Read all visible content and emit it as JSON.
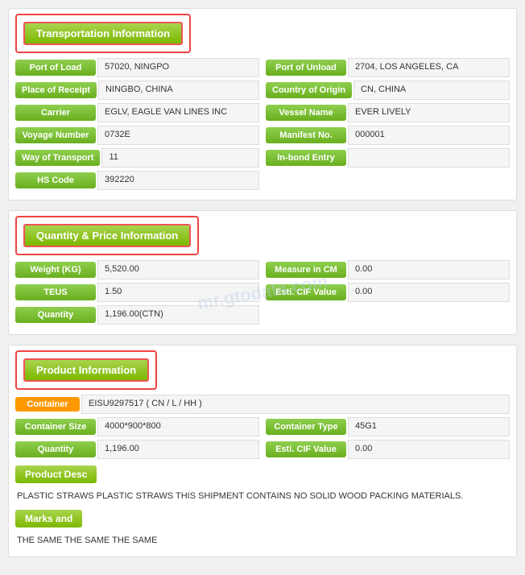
{
  "transportation": {
    "header": "Transportation Information",
    "fields": [
      {
        "left_label": "Port of Load",
        "left_value": "57020, NINGPO",
        "right_label": "Port of Unload",
        "right_value": "2704, LOS ANGELES, CA"
      },
      {
        "left_label": "Place of Receipt",
        "left_value": "NINGBO, CHINA",
        "right_label": "Country of Origin",
        "right_value": "CN, CHINA"
      },
      {
        "left_label": "Carrier",
        "left_value": "EGLV, EAGLE VAN LINES INC",
        "right_label": "Vessel Name",
        "right_value": "EVER LIVELY"
      },
      {
        "left_label": "Voyage Number",
        "left_value": "0732E",
        "right_label": "Manifest No.",
        "right_value": "000001"
      },
      {
        "left_label": "Way of Transport",
        "left_value": "11",
        "right_label": "In-bond Entry",
        "right_value": ""
      },
      {
        "left_label": "HS Code",
        "left_value": "392220",
        "right_label": "",
        "right_value": ""
      }
    ]
  },
  "quantity": {
    "header": "Quantity & Price Information",
    "fields": [
      {
        "left_label": "Weight (KG)",
        "left_value": "5,520.00",
        "right_label": "Measure in CM",
        "right_value": "0.00"
      },
      {
        "left_label": "TEUS",
        "left_value": "1.50",
        "right_label": "Esti. CIF Value",
        "right_value": "0.00"
      },
      {
        "left_label": "Quantity",
        "left_value": "1,196.00(CTN)",
        "right_label": "",
        "right_value": ""
      }
    ],
    "watermark": "mr.gtodata.com"
  },
  "product": {
    "header": "Product Information",
    "container_label": "Container",
    "container_value": "EISU9297517 ( CN / L / HH )",
    "fields": [
      {
        "left_label": "Container Size",
        "left_value": "4000*900*800",
        "right_label": "Container Type",
        "right_value": "45G1"
      },
      {
        "left_label": "Quantity",
        "left_value": "1,196.00",
        "right_label": "Esti. CIF Value",
        "right_value": "0.00"
      }
    ],
    "product_desc_label": "Product Desc",
    "product_desc_text": "PLASTIC STRAWS PLASTIC STRAWS THIS SHIPMENT CONTAINS NO SOLID WOOD PACKING MATERIALS.",
    "marks_label": "Marks and",
    "marks_text": "THE SAME THE SAME THE SAME"
  }
}
